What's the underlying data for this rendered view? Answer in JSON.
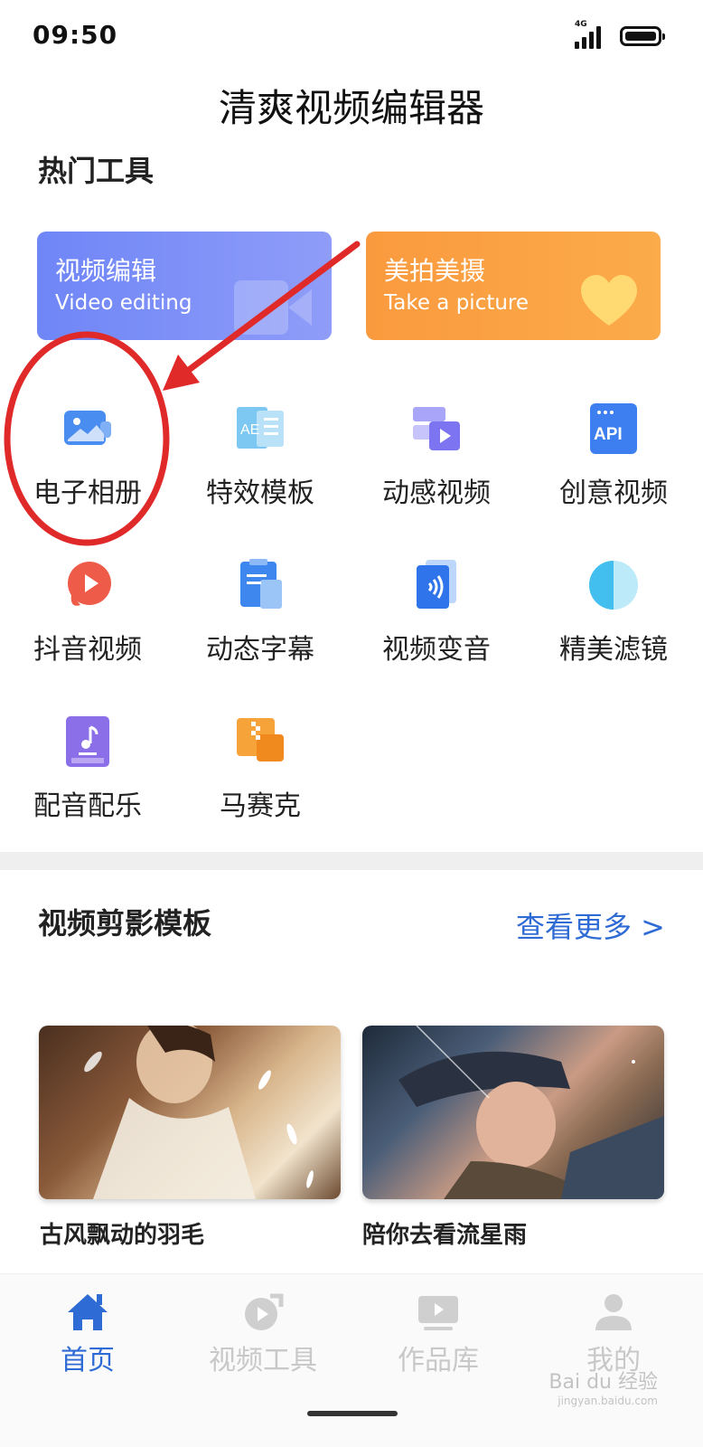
{
  "status_bar": {
    "time": "09:50",
    "network": "4G"
  },
  "app_title": "清爽视频编辑器",
  "hot_tools": {
    "title": "热门工具",
    "cards": [
      {
        "title": "视频编辑",
        "subtitle": "Video editing",
        "icon": "video-camera-icon",
        "color": "#7b8ff7"
      },
      {
        "title": "美拍美摄",
        "subtitle": "Take a picture",
        "icon": "heart-icon",
        "color": "#faa23f"
      }
    ],
    "tools": [
      {
        "label": "电子相册",
        "icon": "photo-album-icon"
      },
      {
        "label": "特效模板",
        "icon": "ae-template-icon"
      },
      {
        "label": "动感视频",
        "icon": "motion-video-icon"
      },
      {
        "label": "创意视频",
        "icon": "api-icon"
      },
      {
        "label": "抖音视频",
        "icon": "play-bubble-icon"
      },
      {
        "label": "动态字幕",
        "icon": "subtitle-icon"
      },
      {
        "label": "视频变音",
        "icon": "voice-change-icon"
      },
      {
        "label": "精美滤镜",
        "icon": "filter-icon"
      },
      {
        "label": "配音配乐",
        "icon": "music-note-icon"
      },
      {
        "label": "马赛克",
        "icon": "mosaic-icon"
      }
    ]
  },
  "templates": {
    "title": "视频剪影模板",
    "see_more": "查看更多 >",
    "items": [
      {
        "name": "古风飘动的羽毛"
      },
      {
        "name": "陪你去看流星雨"
      }
    ]
  },
  "bottom_nav": {
    "items": [
      {
        "label": "首页",
        "icon": "home-icon",
        "active": true
      },
      {
        "label": "视频工具",
        "icon": "video-tools-icon",
        "active": false
      },
      {
        "label": "作品库",
        "icon": "works-icon",
        "active": false
      },
      {
        "label": "我的",
        "icon": "profile-icon",
        "active": false
      }
    ]
  },
  "watermark": {
    "text": "Bai du 经验",
    "sub": "jingyan.baidu.com"
  },
  "colors": {
    "accent": "#2f6bd4",
    "annotation": "#e02a2a"
  }
}
